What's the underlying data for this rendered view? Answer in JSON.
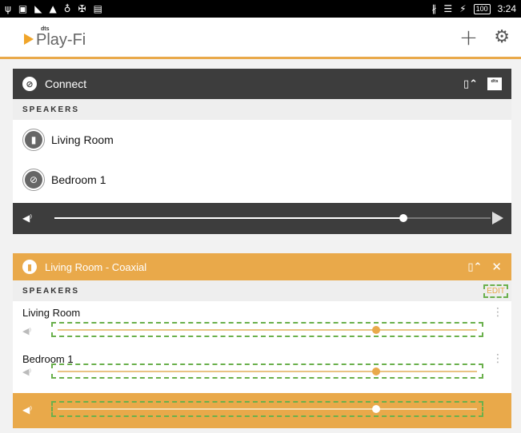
{
  "status_bar": {
    "left_icons": [
      "usb-icon",
      "image-icon",
      "wifi-icon",
      "alert-icon",
      "location-icon",
      "usb-debug-icon",
      "sim-icon"
    ],
    "right_icons": [
      "bluetooth-icon",
      "wifi-signal-icon",
      "charging-icon"
    ],
    "battery": "100",
    "time": "3:24"
  },
  "app_bar": {
    "logo_badge": "dts",
    "logo_text": "Play-Fi",
    "add_icon": "plus-icon",
    "settings_icon": "gear-icon"
  },
  "connect_card": {
    "title": "Connect",
    "section_label": "SPEAKERS",
    "speakers": [
      {
        "name": "Living Room",
        "icon": "speaker-icon"
      },
      {
        "name": "Bedroom 1",
        "icon": "link-icon"
      }
    ],
    "volume": 0.8,
    "dts_badge": "dts"
  },
  "zone_card": {
    "title": "Living Room - Coaxial",
    "section_label": "SPEAKERS",
    "edit_label": "EDIT",
    "zones": [
      {
        "name": "Living Room",
        "volume": 0.76
      },
      {
        "name": "Bedroom 1",
        "volume": 0.76
      }
    ],
    "master_volume": 0.76
  },
  "colors": {
    "accent": "#e9a94a",
    "dark_header": "#3d3d3d",
    "highlight_outline": "#6ab04c"
  }
}
